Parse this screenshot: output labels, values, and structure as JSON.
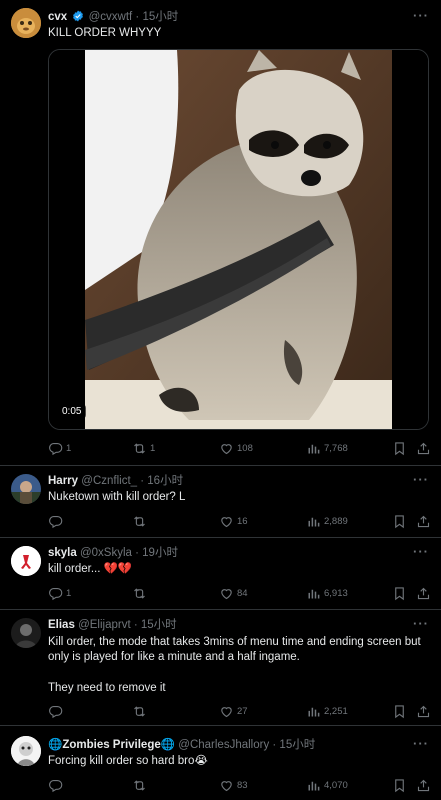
{
  "tweets": [
    {
      "name": "cvx",
      "handle": "@cvxwtf",
      "time": "· 15小时",
      "text": "KILL ORDER WHYYY",
      "video_duration": "0:05",
      "replies": "1",
      "retweets": "1",
      "likes": "108",
      "views": "7,768"
    },
    {
      "name": "Harry",
      "handle": "@Cznflict_",
      "time": "· 16小时",
      "text": "Nuketown with kill order? L",
      "replies": "",
      "retweets": "",
      "likes": "16",
      "views": "2,889"
    },
    {
      "name": "skyla",
      "handle": "@0xSkyla",
      "time": "· 19小时",
      "text": "kill order... 💔💔",
      "replies": "1",
      "retweets": "",
      "likes": "84",
      "views": "6,913"
    },
    {
      "name": "Elias",
      "handle": "@Elijaprvt",
      "time": "· 15小时",
      "text": "Kill order, the mode that takes 3mins of menu time and ending screen but only is played for like a minute and a half ingame.",
      "text2": "They need to remove it",
      "replies": "",
      "retweets": "",
      "likes": "27",
      "views": "2,251"
    },
    {
      "name": "🌐Zombies Privilege🌐",
      "handle": "@CharlesJhallory",
      "time": "· 15小时",
      "text": "Forcing kill order so hard bro😭",
      "replies": "",
      "retweets": "",
      "likes": "83",
      "views": "4,070"
    }
  ],
  "more_label": "···",
  "colors": {
    "background": "#000000",
    "text": "#e7e9ea",
    "muted": "#71767b",
    "border": "#2f3336",
    "verified": "#1d9bf0",
    "heart": "#f91880"
  }
}
